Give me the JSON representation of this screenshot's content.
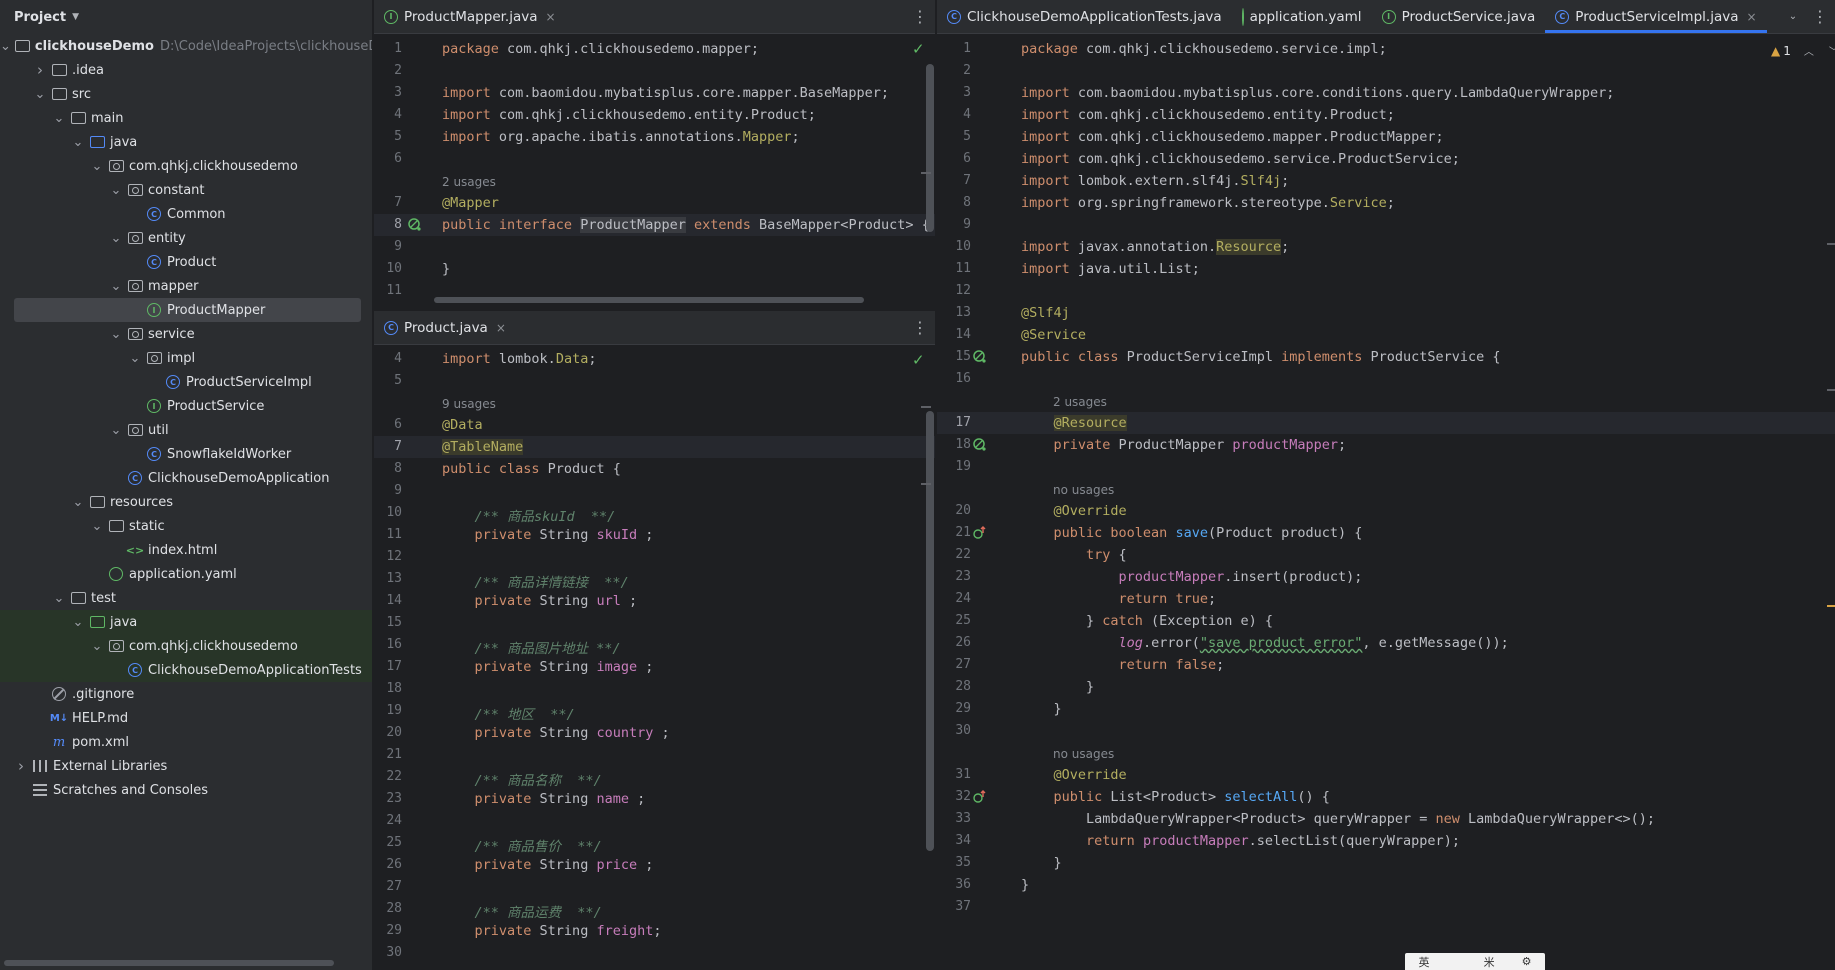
{
  "project_panel": {
    "title": "Project",
    "tree": [
      {
        "label": "clickhouseDemo",
        "hint": "D:\\Code\\IdeaProjects\\clickhouseD",
        "icon": "module-folder-icon",
        "depth": 0,
        "arrow": "down",
        "bold": true
      },
      {
        "label": ".idea",
        "icon": "folder-icon",
        "depth": 1,
        "arrow": "right"
      },
      {
        "label": "src",
        "icon": "folder-icon",
        "depth": 1,
        "arrow": "down"
      },
      {
        "label": "main",
        "icon": "folder-icon",
        "depth": 2,
        "arrow": "down"
      },
      {
        "label": "java",
        "icon": "source-folder-icon",
        "depth": 3,
        "arrow": "down"
      },
      {
        "label": "com.qhkj.clickhousedemo",
        "icon": "package-icon",
        "depth": 4,
        "arrow": "down"
      },
      {
        "label": "constant",
        "icon": "package-icon",
        "depth": 5,
        "arrow": "down"
      },
      {
        "label": "Common",
        "icon": "class-icon",
        "depth": 6
      },
      {
        "label": "entity",
        "icon": "package-icon",
        "depth": 5,
        "arrow": "down"
      },
      {
        "label": "Product",
        "icon": "class-icon",
        "depth": 6
      },
      {
        "label": "mapper",
        "icon": "package-icon",
        "depth": 5,
        "arrow": "down"
      },
      {
        "label": "ProductMapper",
        "icon": "interface-icon",
        "depth": 6,
        "selected": true
      },
      {
        "label": "service",
        "icon": "package-icon",
        "depth": 5,
        "arrow": "down"
      },
      {
        "label": "impl",
        "icon": "package-icon",
        "depth": 6,
        "arrow": "down"
      },
      {
        "label": "ProductServiceImpl",
        "icon": "class-icon",
        "depth": 7
      },
      {
        "label": "ProductService",
        "icon": "interface-icon",
        "depth": 6
      },
      {
        "label": "util",
        "icon": "package-icon",
        "depth": 5,
        "arrow": "down"
      },
      {
        "label": "SnowflakeIdWorker",
        "icon": "class-icon",
        "depth": 6
      },
      {
        "label": "ClickhouseDemoApplication",
        "icon": "spring-class-icon",
        "depth": 5
      },
      {
        "label": "resources",
        "icon": "resources-folder-icon",
        "depth": 3,
        "arrow": "down"
      },
      {
        "label": "static",
        "icon": "folder-icon",
        "depth": 4,
        "arrow": "down"
      },
      {
        "label": "index.html",
        "icon": "html-icon",
        "depth": 5
      },
      {
        "label": "application.yaml",
        "icon": "yaml-icon",
        "depth": 4
      },
      {
        "label": "test",
        "icon": "folder-icon",
        "depth": 2,
        "arrow": "down"
      },
      {
        "label": "java",
        "icon": "test-folder-icon",
        "depth": 3,
        "arrow": "down",
        "test": true
      },
      {
        "label": "com.qhkj.clickhousedemo",
        "icon": "package-icon",
        "depth": 4,
        "arrow": "down",
        "test": true
      },
      {
        "label": "ClickhouseDemoApplicationTests",
        "icon": "spring-class-icon",
        "depth": 5,
        "test": true
      },
      {
        "label": ".gitignore",
        "icon": "gitignore-icon",
        "depth": 1
      },
      {
        "label": "HELP.md",
        "icon": "markdown-icon",
        "depth": 1
      },
      {
        "label": "pom.xml",
        "icon": "maven-icon",
        "depth": 1
      },
      {
        "label": "External Libraries",
        "icon": "library-icon",
        "depth": 0,
        "arrow": "right"
      },
      {
        "label": "Scratches and Consoles",
        "icon": "scratches-icon",
        "depth": 0
      }
    ]
  },
  "mapper_pane": {
    "tabs": [
      {
        "label": "ProductMapper.java",
        "icon": "interface-icon",
        "close": "×",
        "active": false
      }
    ],
    "menu": "⋮",
    "lines": [
      {
        "n": "1",
        "html": "<span class=\"kw\">package</span> com.qhkj.clickhousedemo.mapper;"
      },
      {
        "n": "2",
        "html": ""
      },
      {
        "n": "3",
        "html": "<span class=\"kw\">import</span> com.baomidou.mybatisplus.core.mapper.BaseMapper;"
      },
      {
        "n": "4",
        "html": "<span class=\"kw\">import</span> com.qhkj.clickhousedemo.entity.Product;"
      },
      {
        "n": "5",
        "html": "<span class=\"kw\">import</span> org.apache.ibatis.annotations.<span class=\"an\">Mapper</span>;"
      },
      {
        "n": "6",
        "html": ""
      },
      {
        "usage": "2 usages"
      },
      {
        "n": "7",
        "html": "<span class=\"an\">@Mapper</span>"
      },
      {
        "n": "8",
        "cur": true,
        "gutter": "spring-bean-icon",
        "html": "<span class=\"kw\">public interface</span> <span class=\"hl\">ProductMapper</span> <span class=\"kw\">extends</span> BaseMapper&lt;Product&gt; {"
      },
      {
        "n": "9",
        "html": ""
      },
      {
        "n": "10",
        "html": "}"
      },
      {
        "n": "11",
        "html": ""
      }
    ]
  },
  "product_pane": {
    "tabs": [
      {
        "label": "Product.java",
        "icon": "class-icon",
        "close": "×",
        "active": false
      }
    ],
    "menu": "⋮",
    "lines": [
      {
        "n": "4",
        "html": "<span class=\"kw\">import</span> lombok.<span class=\"an\">Data</span>;"
      },
      {
        "n": "5",
        "html": ""
      },
      {
        "usage": "9 usages"
      },
      {
        "n": "6",
        "html": "<span class=\"an\">@Data</span>"
      },
      {
        "n": "7",
        "cur": true,
        "html": "<span class=\"an-hl\">@TableName</span>"
      },
      {
        "n": "8",
        "html": "<span class=\"kw\">public class</span> Product {"
      },
      {
        "n": "9",
        "html": ""
      },
      {
        "n": "10",
        "html": "    <span class=\"cm\">/** 商品skuId  **/</span>"
      },
      {
        "n": "11",
        "html": "    <span class=\"kw\">private</span> String <span class=\"fld\">skuId</span> ;"
      },
      {
        "n": "12",
        "html": ""
      },
      {
        "n": "13",
        "html": "    <span class=\"cm\">/** 商品详情链接  **/</span>"
      },
      {
        "n": "14",
        "html": "    <span class=\"kw\">private</span> String <span class=\"fld\">url</span> ;"
      },
      {
        "n": "15",
        "html": ""
      },
      {
        "n": "16",
        "html": "    <span class=\"cm\">/** 商品图片地址 **/</span>"
      },
      {
        "n": "17",
        "html": "    <span class=\"kw\">private</span> String <span class=\"fld\">image</span> ;"
      },
      {
        "n": "18",
        "html": ""
      },
      {
        "n": "19",
        "html": "    <span class=\"cm\">/** 地区  **/</span>"
      },
      {
        "n": "20",
        "html": "    <span class=\"kw\">private</span> String <span class=\"fld\">country</span> ;"
      },
      {
        "n": "21",
        "html": ""
      },
      {
        "n": "22",
        "html": "    <span class=\"cm\">/** 商品名称  **/</span>"
      },
      {
        "n": "23",
        "html": "    <span class=\"kw\">private</span> String <span class=\"fld\">name</span> ;"
      },
      {
        "n": "24",
        "html": ""
      },
      {
        "n": "25",
        "html": "    <span class=\"cm\">/** 商品售价  **/</span>"
      },
      {
        "n": "26",
        "html": "    <span class=\"kw\">private</span> String <span class=\"fld\">price</span> ;"
      },
      {
        "n": "27",
        "html": ""
      },
      {
        "n": "28",
        "html": "    <span class=\"cm\">/** 商品运费  **/</span>"
      },
      {
        "n": "29",
        "html": "    <span class=\"kw\">private</span> String <span class=\"fld\">freight</span>;"
      },
      {
        "n": "30",
        "html": ""
      }
    ]
  },
  "service_pane": {
    "tabs": [
      {
        "label": "ClickhouseDemoApplicationTests.java",
        "icon": "spring-class-icon",
        "active": false
      },
      {
        "label": "application.yaml",
        "icon": "yaml-icon",
        "active": false
      },
      {
        "label": "ProductService.java",
        "icon": "interface-icon",
        "active": false
      },
      {
        "label": "ProductServiceImpl.java",
        "icon": "class-icon",
        "close": "×",
        "active": true
      }
    ],
    "chevron": "⌄",
    "menu": "⋮",
    "warnings": "1",
    "lines": [
      {
        "n": "1",
        "html": "<span class=\"kw\">package</span> com.qhkj.clickhousedemo.service.impl;"
      },
      {
        "n": "2",
        "html": ""
      },
      {
        "n": "3",
        "html": "<span class=\"kw\">import</span> com.baomidou.mybatisplus.core.conditions.query.LambdaQueryWrapper;"
      },
      {
        "n": "4",
        "html": "<span class=\"kw\">import</span> com.qhkj.clickhousedemo.entity.Product;"
      },
      {
        "n": "5",
        "html": "<span class=\"kw\">import</span> com.qhkj.clickhousedemo.mapper.ProductMapper;"
      },
      {
        "n": "6",
        "html": "<span class=\"kw\">import</span> com.qhkj.clickhousedemo.service.ProductService;"
      },
      {
        "n": "7",
        "html": "<span class=\"kw\">import</span> lombok.extern.slf4j.<span class=\"an\">Slf4j</span>;"
      },
      {
        "n": "8",
        "html": "<span class=\"kw\">import</span> org.springframework.stereotype.<span class=\"an\">Service</span>;"
      },
      {
        "n": "9",
        "html": ""
      },
      {
        "n": "10",
        "html": "<span class=\"kw\">import</span> javax.annotation.<span class=\"an-hl\">Resource</span>;"
      },
      {
        "n": "11",
        "html": "<span class=\"kw\">import</span> java.util.List;"
      },
      {
        "n": "12",
        "html": ""
      },
      {
        "n": "13",
        "html": "<span class=\"an\">@Slf4j</span>"
      },
      {
        "n": "14",
        "html": "<span class=\"an\">@Service</span>"
      },
      {
        "n": "15",
        "gutter": "spring-bean-icon",
        "html": "<span class=\"kw\">public class</span> ProductServiceImpl <span class=\"kw\">implements</span> ProductService {"
      },
      {
        "n": "16",
        "html": ""
      },
      {
        "usage": "2 usages",
        "indent": true
      },
      {
        "n": "17",
        "cur": true,
        "html": "    <span class=\"an-hl\">@Resource</span>"
      },
      {
        "n": "18",
        "gutter": "spring-bean-icon",
        "html": "    <span class=\"kw\">private</span> ProductMapper <span class=\"fld\">productMapper</span>;"
      },
      {
        "n": "19",
        "html": ""
      },
      {
        "usage": "no usages",
        "indent": true
      },
      {
        "n": "20",
        "html": "    <span class=\"an\">@Override</span>"
      },
      {
        "n": "21",
        "gutter": "override-icon",
        "html": "    <span class=\"kw\">public boolean</span> <span class=\"fn\">save</span>(Product product) {"
      },
      {
        "n": "22",
        "html": "        <span class=\"kw\">try</span> {"
      },
      {
        "n": "23",
        "html": "            <span class=\"fld\">productMapper</span>.insert(product);"
      },
      {
        "n": "24",
        "html": "            <span class=\"kw\">return true</span>;"
      },
      {
        "n": "25",
        "html": "        } <span class=\"kw\">catch</span> (Exception e) {"
      },
      {
        "n": "26",
        "html": "            <span class=\"lg\">log</span>.error(<span class=\"str\">\"save product error\"</span>, e.getMessage());"
      },
      {
        "n": "27",
        "html": "            <span class=\"kw\">return false</span>;"
      },
      {
        "n": "28",
        "html": "        }"
      },
      {
        "n": "29",
        "html": "    }"
      },
      {
        "n": "30",
        "html": ""
      },
      {
        "usage": "no usages",
        "indent": true
      },
      {
        "n": "31",
        "html": "    <span class=\"an\">@Override</span>"
      },
      {
        "n": "32",
        "gutter": "override-icon",
        "html": "    <span class=\"kw\">public</span> List&lt;Product&gt; <span class=\"fn\">selectAll</span>() {"
      },
      {
        "n": "33",
        "html": "        LambdaQueryWrapper&lt;Product&gt; queryWrapper = <span class=\"kw\">new</span> LambdaQueryWrapper&lt;&gt;();"
      },
      {
        "n": "34",
        "html": "        <span class=\"kw\">return</span> <span class=\"fld\">productMapper</span>.selectList(queryWrapper);"
      },
      {
        "n": "35",
        "html": "    }"
      },
      {
        "n": "36",
        "html": "}"
      },
      {
        "n": "37",
        "html": ""
      }
    ]
  },
  "ime_toolbar": {
    "items": [
      "英",
      "",
      "米",
      "⚙"
    ]
  },
  "colors": {
    "accent": "#3574f0",
    "background": "#1e1f22",
    "panel": "#2b2d30"
  }
}
